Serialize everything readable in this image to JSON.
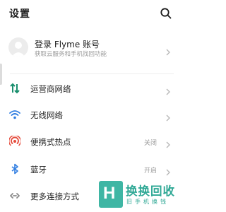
{
  "header": {
    "title": "设置"
  },
  "account": {
    "title": "登录 Flyme 账号",
    "subtitle": "获取云服务和手机找回功能"
  },
  "items": [
    {
      "label": "运营商网络",
      "value": "",
      "icon": "network-icon"
    },
    {
      "label": "无线网络",
      "value": "",
      "icon": "wifi-icon"
    },
    {
      "label": "便携式热点",
      "value": "关闭",
      "icon": "hotspot-icon"
    },
    {
      "label": "蓝牙",
      "value": "开启",
      "icon": "bluetooth-icon"
    },
    {
      "label": "更多连接方式",
      "value": "",
      "icon": "link-icon"
    }
  ],
  "watermark": {
    "logo_letter": "H",
    "text": "换换回收",
    "subtext": "旧手机换钱"
  },
  "colors": {
    "network": "#1a8f6e",
    "wifi": "#2f7de1",
    "hotspot": "#e54b3c",
    "bluetooth": "#2f7de1",
    "link": "#8a8a8a",
    "watermark": "#2fa895"
  }
}
